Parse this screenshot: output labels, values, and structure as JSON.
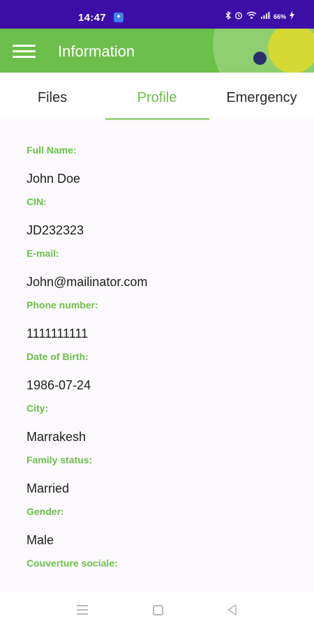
{
  "status_bar": {
    "time": "14:47",
    "notification_icon": "app-notification-icon",
    "icons": [
      "bluetooth-icon",
      "alarm-icon",
      "wifi-icon",
      "signal-icon"
    ],
    "battery": "66%",
    "background": "#3d0da8"
  },
  "app_bar": {
    "title": "Information",
    "menu_icon": "hamburger-menu-icon",
    "background": "#6cbf4a"
  },
  "tabs": [
    {
      "label": "Files",
      "active": false
    },
    {
      "label": "Profile",
      "active": true
    },
    {
      "label": "Emergency",
      "active": false
    }
  ],
  "profile": {
    "fields": [
      {
        "label": "Full Name:",
        "value": "John Doe"
      },
      {
        "label": "CIN:",
        "value": "JD232323"
      },
      {
        "label": "E-mail:",
        "value": "John@mailinator.com"
      },
      {
        "label": "Phone number:",
        "value": "1111111111"
      },
      {
        "label": "Date of Birth:",
        "value": "1986-07-24"
      },
      {
        "label": "City:",
        "value": "Marrakesh"
      },
      {
        "label": "Family status:",
        "value": "Married"
      },
      {
        "label": "Gender:",
        "value": "Male"
      },
      {
        "label": "Couverture sociale:",
        "value": ""
      }
    ]
  },
  "colors": {
    "accent": "#6cbf4a",
    "accent_light": "#9fd488",
    "status_bar": "#3d0da8"
  },
  "bottom_nav": {
    "icons": [
      "recent-apps-icon",
      "home-icon",
      "back-icon"
    ]
  }
}
